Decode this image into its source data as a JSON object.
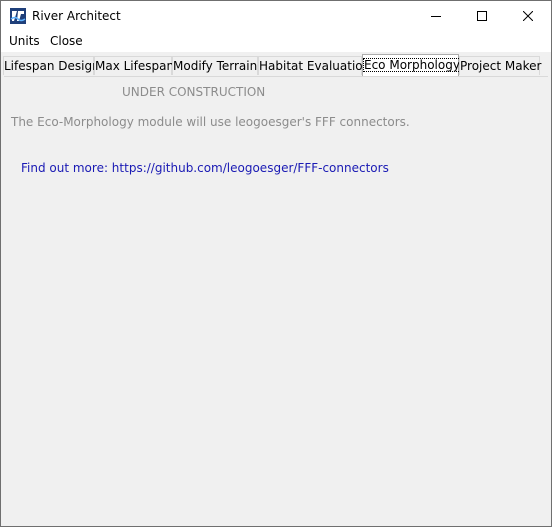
{
  "window": {
    "title": "River Architect",
    "icon": "river-architect-logo-icon"
  },
  "titlebar_buttons": {
    "minimize_icon": "minimize-icon",
    "maximize_icon": "maximize-icon",
    "close_icon": "close-icon"
  },
  "menu": {
    "items": [
      {
        "label": "Units"
      },
      {
        "label": "Close"
      }
    ]
  },
  "tabs": [
    {
      "label": "Lifespan Design",
      "active": false
    },
    {
      "label": "Max Lifespan",
      "active": false
    },
    {
      "label": "Modify Terrain",
      "active": false
    },
    {
      "label": "Habitat Evaluation",
      "active": false
    },
    {
      "label": "Eco Morphology",
      "active": true
    },
    {
      "label": "Project Maker",
      "active": false
    }
  ],
  "content": {
    "heading": "UNDER CONSTRUCTION",
    "description": "The Eco-Morphology module will use leogoesger's FFF connectors.",
    "link_text": "Find out more: https://github.com/leogoesger/FFF-connectors",
    "heading_color": "#8c8c8c",
    "link_color": "#1a1ab4"
  }
}
